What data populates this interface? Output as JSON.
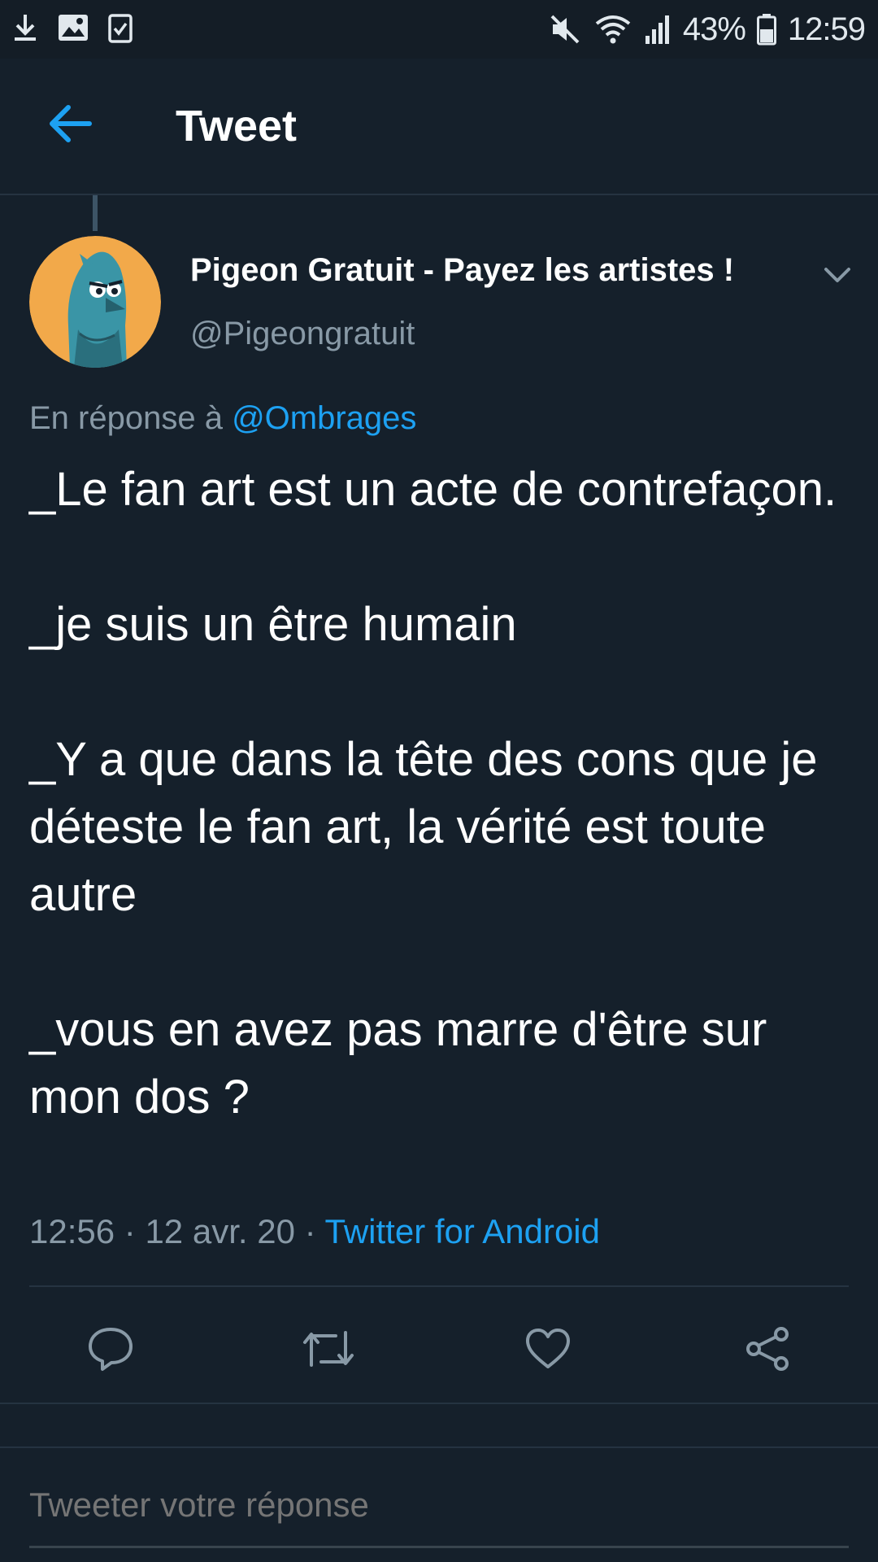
{
  "status_bar": {
    "battery": "43%",
    "time": "12:59"
  },
  "header": {
    "title": "Tweet"
  },
  "tweet": {
    "author_name": "Pigeon Gratuit - Payez les artistes !",
    "author_handle": "@Pigeongratuit",
    "reply_prefix": "En réponse à",
    "reply_to": "@Ombrages",
    "paragraphs": [
      "_Le fan art est un acte de contrefaçon.",
      "_je suis un être humain",
      "_Y a que dans la tête des cons que je déteste le fan art, la vérité est toute autre",
      "_vous en avez pas marre d'être sur mon dos ?"
    ],
    "time": "12:56",
    "date": "12 avr. 20",
    "source": "Twitter for Android"
  },
  "compose": {
    "placeholder": "Tweeter votre réponse"
  },
  "colors": {
    "background": "#15202b",
    "accent": "#1da1f2",
    "secondary_text": "#8899a6",
    "divider": "#253341"
  }
}
